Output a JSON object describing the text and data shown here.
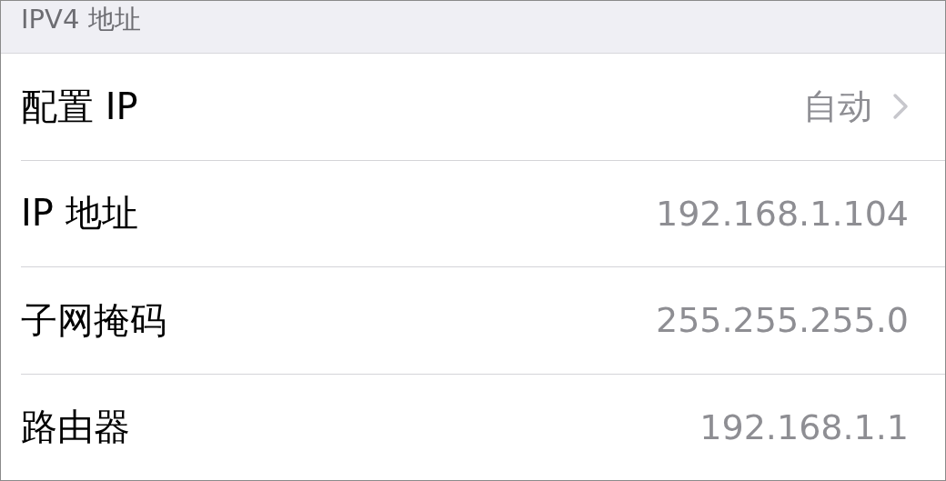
{
  "section_header": "IPV4 地址",
  "rows": [
    {
      "label": "配置 IP",
      "value": "自动",
      "kind": "link"
    },
    {
      "label": "IP 地址",
      "value": "192.168.1.104",
      "kind": "info"
    },
    {
      "label": "子网掩码",
      "value": "255.255.255.0",
      "kind": "info"
    },
    {
      "label": "路由器",
      "value": "192.168.1.1",
      "kind": "info"
    }
  ]
}
